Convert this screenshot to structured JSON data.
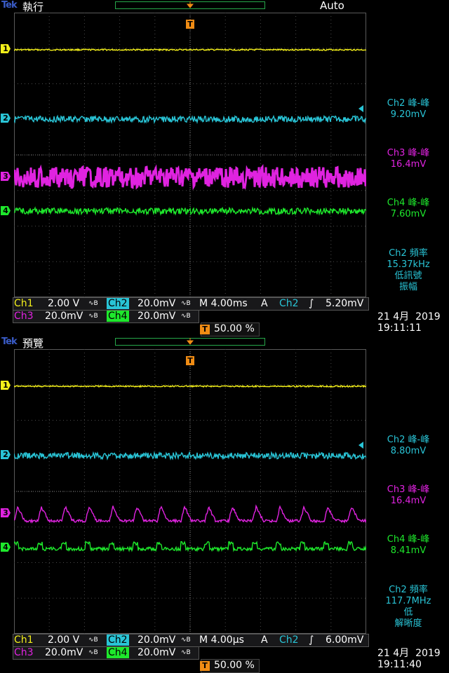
{
  "screens": [
    {
      "brand": "Tek",
      "mode": "執行",
      "trigger_status": "Auto",
      "measurements": [
        {
          "title": "Ch2 峰-峰",
          "value": "9.20mV",
          "color": "#29c4d6"
        },
        {
          "title": "Ch3 峰-峰",
          "value": "16.4mV",
          "color": "#e023e0"
        },
        {
          "title": "Ch4 峰-峰",
          "value": "7.60mV",
          "color": "#1ee82c"
        }
      ],
      "freq": {
        "title": "Ch2 頻率",
        "value": "15.37kHz",
        "note1": "低訊號",
        "note2": "振幅"
      },
      "channels": {
        "ch1": {
          "label": "Ch1",
          "scale": "2.00 V"
        },
        "ch2": {
          "label": "Ch2",
          "scale": "20.0mV"
        },
        "ch3": {
          "label": "Ch3",
          "scale": "20.0mV"
        },
        "ch4": {
          "label": "Ch4",
          "scale": "20.0mV"
        }
      },
      "bw_symbol": "∿B",
      "timebase": "M 4.00ms",
      "acq": "A",
      "trigger": {
        "source": "Ch2",
        "slope": "∫",
        "level": "5.20mV"
      },
      "trigger_position": "50.00 %",
      "date": "21 4月  2019",
      "time": "19:11:11",
      "waveforms": {
        "ch1": "flat",
        "ch2": "noise",
        "ch3": "dense-noise",
        "ch4": "noise"
      }
    },
    {
      "brand": "Tek",
      "mode": "預覽",
      "trigger_status": "",
      "measurements": [
        {
          "title": "Ch2 峰-峰",
          "value": "8.80mV",
          "color": "#29c4d6"
        },
        {
          "title": "Ch3 峰-峰",
          "value": "16.4mV",
          "color": "#e023e0"
        },
        {
          "title": "Ch4 峰-峰",
          "value": "8.41mV",
          "color": "#1ee82c"
        }
      ],
      "freq": {
        "title": "Ch2 頻率",
        "value": "117.7MHz",
        "note1": "低",
        "note2": "解晰度"
      },
      "channels": {
        "ch1": {
          "label": "Ch1",
          "scale": "2.00 V"
        },
        "ch2": {
          "label": "Ch2",
          "scale": "20.0mV"
        },
        "ch3": {
          "label": "Ch3",
          "scale": "20.0mV"
        },
        "ch4": {
          "label": "Ch4",
          "scale": "20.0mV"
        }
      },
      "bw_symbol": "∿B",
      "timebase": "M 4.00µs",
      "acq": "A",
      "trigger": {
        "source": "Ch2",
        "slope": "∫",
        "level": "6.00mV"
      },
      "trigger_position": "50.00 %",
      "date": "21 4月  2019",
      "time": "19:11:40",
      "waveforms": {
        "ch1": "flat",
        "ch2": "noise",
        "ch3": "periodic",
        "ch4": "periodic-small"
      }
    }
  ],
  "channel_markers": [
    "1",
    "2",
    "3",
    "4"
  ],
  "trigger_marker": "T",
  "colors": {
    "ch1": "#f4f01a",
    "ch2": "#29c4d6",
    "ch3": "#e023e0",
    "ch4": "#1ee82c",
    "trigger": "#f08c14",
    "grid": "#4a4a4a",
    "brand": "#3a5cc8"
  }
}
